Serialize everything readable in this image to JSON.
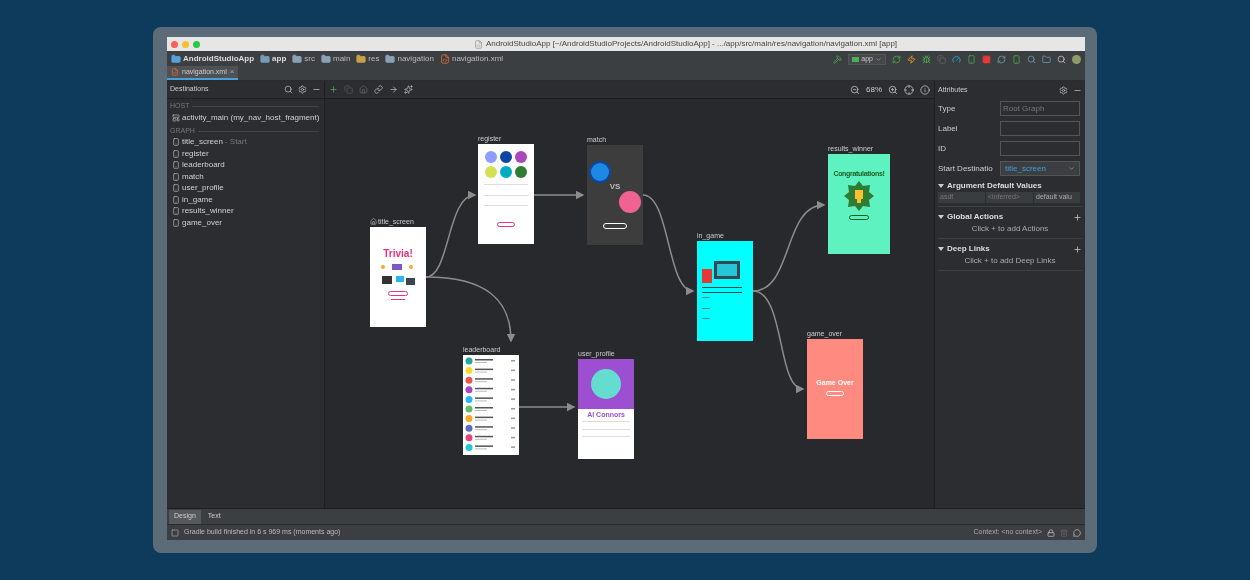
{
  "window": {
    "title": "AndroidStudioApp [~/AndroidStudioProjects/AndroidStudioApp] - .../app/src/main/res/navigation/navigation.xml [app]"
  },
  "breadcrumbs": [
    {
      "label": "AndroidStudioApp",
      "kind": "project"
    },
    {
      "label": "app",
      "kind": "module"
    },
    {
      "label": "src",
      "kind": "folder"
    },
    {
      "label": "main",
      "kind": "folder"
    },
    {
      "label": "res",
      "kind": "res"
    },
    {
      "label": "navigation",
      "kind": "folder"
    },
    {
      "label": "navigation.xml",
      "kind": "file"
    }
  ],
  "run_config": {
    "label": "app"
  },
  "editor_tabs": [
    {
      "label": "navigation.xml",
      "selected": true,
      "close": "×"
    }
  ],
  "destinations_panel": {
    "title": "Destinations",
    "sections": [
      {
        "heading": "HOST",
        "items": [
          {
            "label": "activity_main (my_nav_host_fragment)",
            "kind": "host"
          }
        ]
      },
      {
        "heading": "GRAPH",
        "items": [
          {
            "label": "title_screen",
            "suffix": "- Start",
            "kind": "fragment"
          },
          {
            "label": "register",
            "kind": "fragment"
          },
          {
            "label": "leaderboard",
            "kind": "fragment"
          },
          {
            "label": "match",
            "kind": "fragment"
          },
          {
            "label": "user_profile",
            "kind": "fragment"
          },
          {
            "label": "in_game",
            "kind": "fragment"
          },
          {
            "label": "results_winner",
            "kind": "fragment"
          },
          {
            "label": "game_over",
            "kind": "fragment"
          }
        ]
      }
    ]
  },
  "canvas": {
    "zoom": "68%",
    "nodes": [
      {
        "label": "title_screen",
        "start": true,
        "texts": [
          "Trivia!"
        ]
      },
      {
        "label": "register",
        "start": false
      },
      {
        "label": "match",
        "start": false,
        "texts": [
          "VS"
        ]
      },
      {
        "label": "in_game",
        "start": false
      },
      {
        "label": "results_winner",
        "start": false,
        "texts": [
          "Congratulations!"
        ]
      },
      {
        "label": "game_over",
        "start": false,
        "texts": [
          "Game Over"
        ]
      },
      {
        "label": "leaderboard",
        "start": false
      },
      {
        "label": "user_profile",
        "start": false,
        "texts": [
          "Al Connors"
        ]
      }
    ]
  },
  "attributes": {
    "title": "Attributes",
    "fields": [
      {
        "label": "Type",
        "value": "Root Graph",
        "kind": "readonly"
      },
      {
        "label": "Label",
        "kind": "text"
      },
      {
        "label": "ID",
        "kind": "text"
      },
      {
        "label": "Start Destinatio",
        "value": "title_screen",
        "kind": "dropdown"
      }
    ],
    "sections": [
      {
        "title": "Argument Default Values",
        "expanded": true,
        "addable": false,
        "cells": [
          "asdf",
          "<inferred>",
          "default valu"
        ]
      },
      {
        "title": "Global Actions",
        "expanded": true,
        "addable": true,
        "hint": "Click + to add Actions"
      },
      {
        "title": "Deep Links",
        "expanded": true,
        "addable": true,
        "hint": "Click + to add Deep Links"
      }
    ]
  },
  "bottom_tabs": [
    {
      "label": "Design",
      "selected": true
    },
    {
      "label": "Text",
      "selected": false
    }
  ],
  "status_bar": {
    "message": "Gradle build finished in 6 s 969 ms (moments ago)",
    "context": "Context: <no context>"
  }
}
